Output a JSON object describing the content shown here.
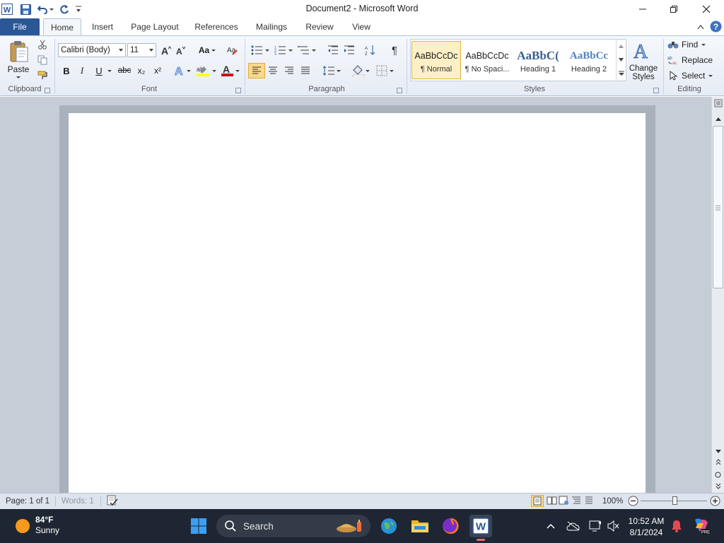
{
  "titlebar": {
    "title": "Document2 - Microsoft Word",
    "app_icon": "word-app-icon",
    "quick_access": [
      "save-icon",
      "undo-icon",
      "redo-icon",
      "customize-qat-icon"
    ]
  },
  "tabs": [
    {
      "label": "File"
    },
    {
      "label": "Home"
    },
    {
      "label": "Insert"
    },
    {
      "label": "Page Layout"
    },
    {
      "label": "References"
    },
    {
      "label": "Mailings"
    },
    {
      "label": "Review"
    },
    {
      "label": "View"
    }
  ],
  "ribbon": {
    "clipboard": {
      "paste_label": "Paste",
      "group_label": "Clipboard"
    },
    "font": {
      "font_name": "Calibri (Body)",
      "font_size": "11",
      "change_case_label": "Aa",
      "bold": "B",
      "italic": "I",
      "underline": "U",
      "strikethrough": "abc",
      "subscript": "x₂",
      "superscript": "x²",
      "font_color_label": "A",
      "group_label": "Font"
    },
    "paragraph": {
      "pilcrow": "¶",
      "group_label": "Paragraph"
    },
    "styles": {
      "items": [
        {
          "sample": "AaBbCcDc",
          "name": "¶ Normal"
        },
        {
          "sample": "AaBbCcDc",
          "name": "¶ No Spaci..."
        },
        {
          "sample": "AaBbC(",
          "name": "Heading 1"
        },
        {
          "sample": "AaBbCc",
          "name": "Heading 2"
        }
      ],
      "change_styles_label": "Change Styles",
      "group_label": "Styles"
    },
    "editing": {
      "find_label": "Find",
      "replace_label": "Replace",
      "select_label": "Select",
      "group_label": "Editing"
    }
  },
  "document": {
    "text": ""
  },
  "statusbar": {
    "page": "Page: 1 of 1",
    "words": "Words: 1",
    "zoom": "100%"
  },
  "taskbar": {
    "temperature": "84°F",
    "weather": "Sunny",
    "search_label": "Search",
    "time": "10:52 AM",
    "date": "8/1/2024"
  },
  "colors": {
    "file_tab": "#2b5797",
    "accent_blue": "#2b5797",
    "taskbar": "#1f2633",
    "selected_style": "#fdf0c6"
  }
}
